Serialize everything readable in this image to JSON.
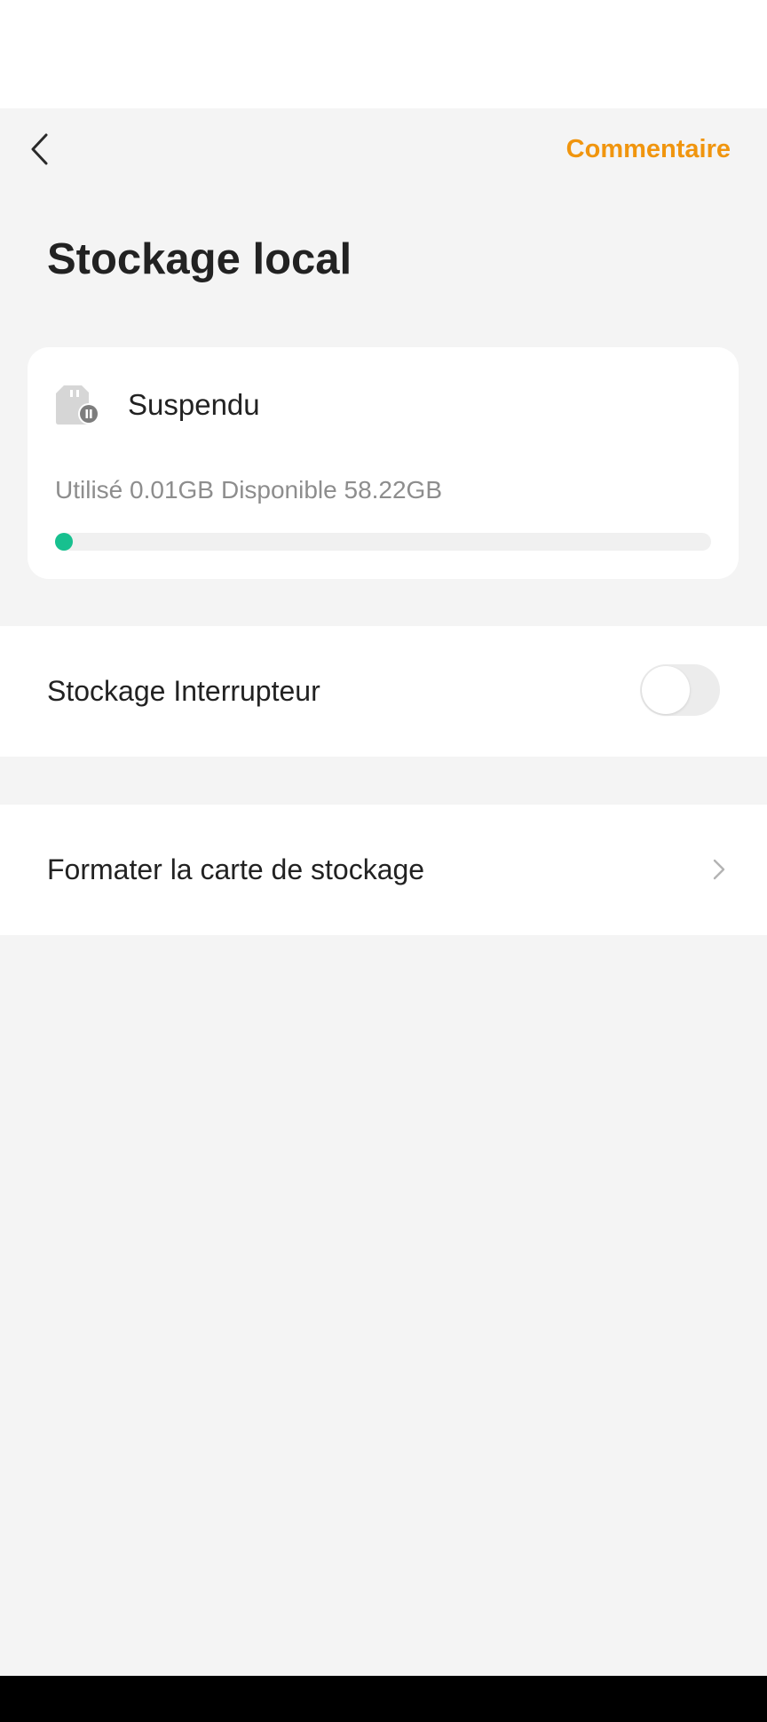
{
  "header": {
    "back_icon": "chevron-left-icon",
    "comment_label": "Commentaire",
    "title": "Stockage local"
  },
  "storage_card": {
    "icon": "sd-card-paused-icon",
    "status": "Suspendu",
    "used_label": "Utilisé 0.01GB",
    "available_label": "Disponible 58.22GB",
    "used_fraction": 0.0002,
    "progress_color": "#17c08f"
  },
  "settings": {
    "storage_switch_label": "Stockage Interrupteur",
    "storage_switch_on": false,
    "format_label": "Formater la carte de stockage",
    "format_icon": "chevron-right-icon"
  },
  "colors": {
    "accent": "#f0950e",
    "background": "#f4f4f4",
    "card": "#ffffff"
  }
}
